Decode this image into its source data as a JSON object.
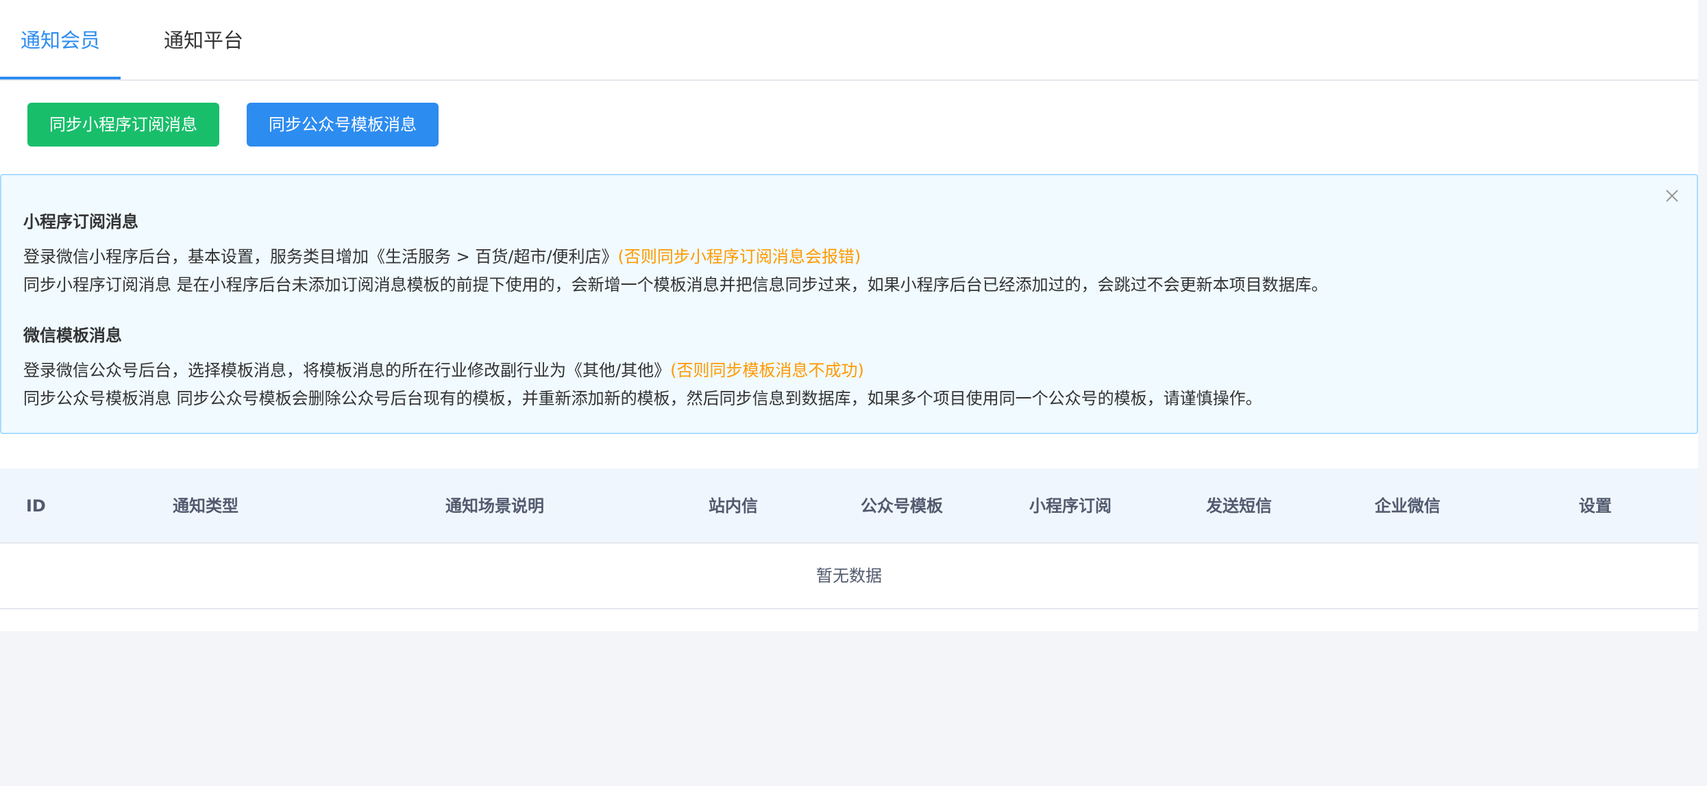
{
  "tabs": [
    {
      "label": "通知会员",
      "active": true
    },
    {
      "label": "通知平台",
      "active": false
    }
  ],
  "buttons": {
    "sync_miniprogram_label": "同步小程序订阅消息",
    "sync_official_label": "同步公众号模板消息"
  },
  "alert": {
    "close_icon": "close-icon",
    "section1": {
      "title": "小程序订阅消息",
      "line1_text": "登录微信小程序后台，基本设置，服务类目增加《生活服务 > 百货/超市/便利店》",
      "line1_warning": "(否则同步小程序订阅消息会报错)",
      "line2_text": "同步小程序订阅消息 是在小程序后台未添加订阅消息模板的前提下使用的，会新增一个模板消息并把信息同步过来，如果小程序后台已经添加过的，会跳过不会更新本项目数据库。"
    },
    "section2": {
      "title": "微信模板消息",
      "line1_text": "登录微信公众号后台，选择模板消息，将模板消息的所在行业修改副行业为《其他/其他》",
      "line1_warning": "(否则同步模板消息不成功)",
      "line2_text": "同步公众号模板消息 同步公众号模板会删除公众号后台现有的模板，并重新添加新的模板，然后同步信息到数据库，如果多个项目使用同一个公众号的模板，请谨慎操作。"
    }
  },
  "table": {
    "columns": [
      "ID",
      "通知类型",
      "通知场景说明",
      "站内信",
      "公众号模板",
      "小程序订阅",
      "发送短信",
      "企业微信",
      "设置"
    ],
    "empty_text": "暂无数据"
  },
  "colors": {
    "primary": "#2d8cf0",
    "success": "#19be6b",
    "warning": "#ff9900",
    "alert_bg": "#f0faff",
    "alert_border": "#abdcff",
    "table_header_bg": "#f0f6fd",
    "page_bg": "#f3f5f8"
  }
}
